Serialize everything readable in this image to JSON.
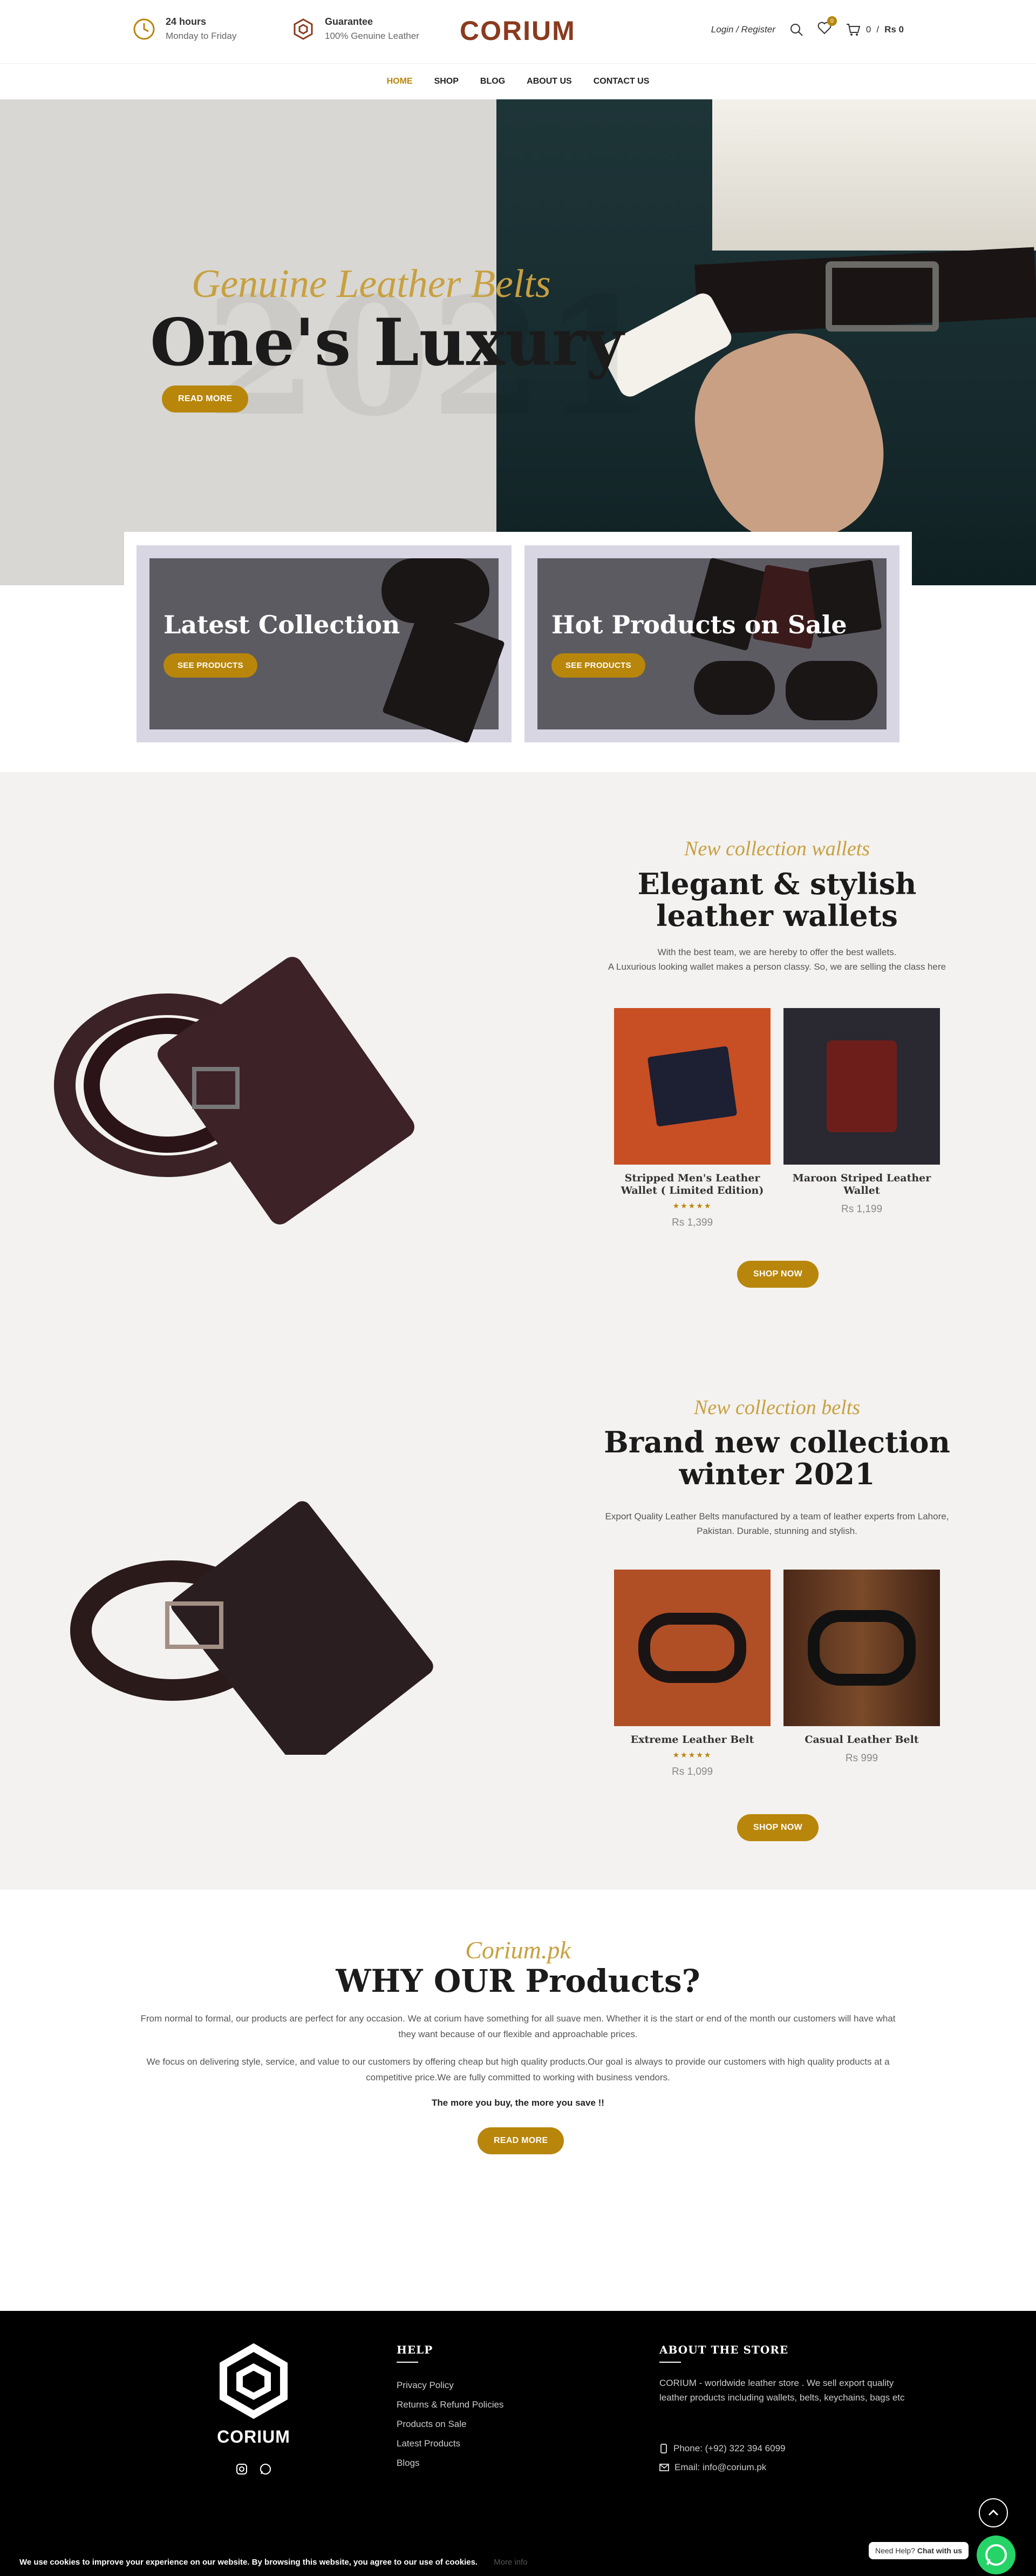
{
  "topbar": {
    "hours_title": "24 hours",
    "hours_sub": "Monday to Friday",
    "guarantee_title": "Guarantee",
    "guarantee_sub": "100% Genuine Leather",
    "logo": "CORIUM",
    "login": "Login / Register",
    "wishlist_count": "0",
    "cart_count": "0",
    "cart_total": "Rs 0"
  },
  "nav": {
    "items": [
      {
        "label": "HOME"
      },
      {
        "label": "SHOP"
      },
      {
        "label": "BLOG"
      },
      {
        "label": "ABOUT US"
      },
      {
        "label": "CONTACT US"
      }
    ]
  },
  "hero": {
    "bg_text": "2021",
    "subtitle": "Genuine Leather Belts",
    "title": "One's Luxury",
    "button": "READ MORE"
  },
  "promos": [
    {
      "title": "Latest Collection",
      "button": "SEE PRODUCTS"
    },
    {
      "title": "Hot Products on Sale",
      "button": "SEE PRODUCTS"
    }
  ],
  "wallets": {
    "subtitle": "New collection wallets",
    "title": "Elegant & stylish leather wallets",
    "desc1": "With the best team, we are hereby to offer the best wallets.",
    "desc2": "A Luxurious looking wallet makes a person classy. So, we are selling the class here",
    "products": [
      {
        "name": "Stripped Men's Leather Wallet ( Limited Edition)",
        "stars": "★★★★★",
        "price": "Rs 1,399"
      },
      {
        "name": "Maroon Striped Leather Wallet",
        "stars": "",
        "price": "Rs 1,199"
      }
    ],
    "button": "SHOP NOW"
  },
  "belts": {
    "subtitle": "New collection belts",
    "title": "Brand new collection winter 2021",
    "desc": "Export Quality Leather Belts manufactured by a team of leather experts from Lahore, Pakistan. Durable, stunning and stylish.",
    "products": [
      {
        "name": "Extreme Leather Belt",
        "stars": "★★★★★",
        "price": "Rs 1,099"
      },
      {
        "name": "Casual Leather Belt",
        "stars": "",
        "price": "Rs 999"
      }
    ],
    "button": "SHOP NOW"
  },
  "why": {
    "subtitle": "Corium.pk",
    "title": "WHY OUR Products?",
    "p1": "From normal to formal, our products are perfect for any occasion. We at corium have something for all suave men. Whether it is the start or end of the month our customers will have what they want because of our flexible and approachable prices.",
    "p2": "We focus on delivering style, service, and value to our customers by offering cheap but high quality products.Our goal is always to provide our customers with high quality products at a competitive price.We are fully committed to working with business vendors.",
    "strong": "The more you buy, the more you save !!",
    "button": "READ MORE"
  },
  "footer": {
    "logo_word": "CORIUM",
    "help_title": "HELP",
    "help_links": [
      "Privacy Policy",
      "Returns & Refund Policies",
      "Products on Sale",
      "Latest Products",
      "Blogs"
    ],
    "about_title": "ABOUT THE STORE",
    "about_text": "CORIUM - worldwide leather store . We sell export quality leather products including wallets, belts, keychains, bags etc",
    "phone": "Phone: (+92) 322 394 6099",
    "email": "Email: info@corium.pk"
  },
  "cookie": {
    "text": "We use cookies to improve your experience on our website. By browsing this website, you agree to our use of cookies.",
    "more": "More info"
  },
  "help_widget": {
    "text": "Need Help?",
    "strong": "Chat with us"
  },
  "colors": {
    "accent": "#b8860b",
    "logo": "#8b3a1e",
    "footer_bg": "#000000",
    "section_bg": "#f3f2f0"
  }
}
